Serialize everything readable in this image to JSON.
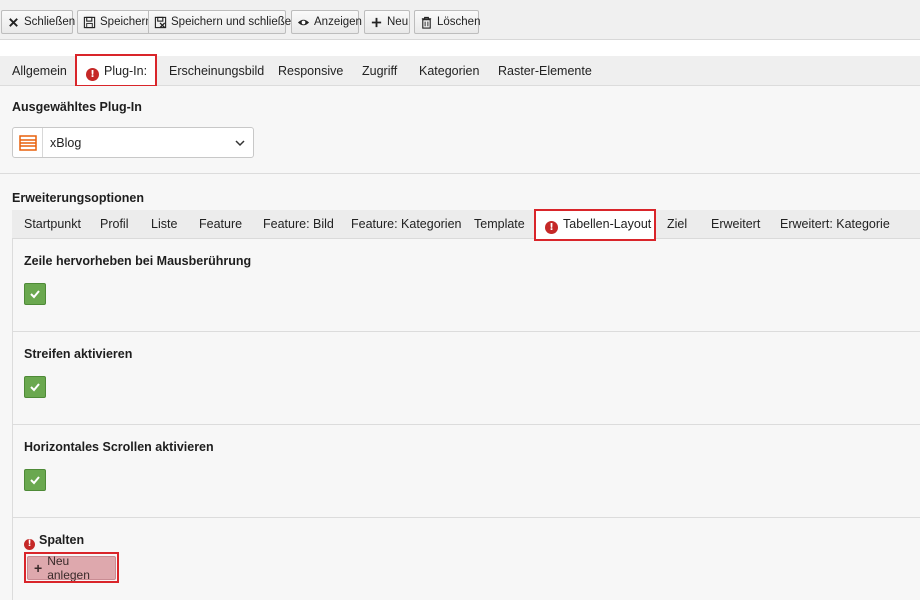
{
  "toolbar": {
    "close": "Schließen",
    "save": "Speichern",
    "save_close": "Speichern und schließen",
    "view": "Anzeigen",
    "new": "Neu",
    "delete": "Löschen"
  },
  "outer_tabs": [
    "Allgemein",
    "Plug-In:",
    "Erscheinungsbild",
    "Responsive",
    "Zugriff",
    "Kategorien",
    "Raster-Elemente"
  ],
  "selected_plugin": {
    "label": "Ausgewähltes Plug-In",
    "value": "xBlog"
  },
  "extension_options": {
    "label": "Erweiterungsoptionen",
    "tabs": [
      "Startpunkt",
      "Profil",
      "Liste",
      "Feature",
      "Feature: Bild",
      "Feature: Kategorien",
      "Template",
      "Tabellen-Layout",
      "Ziel",
      "Erweitert",
      "Erweitert: Kategorie"
    ]
  },
  "options": {
    "hover": "Zeile hervorheben bei Mausberührung",
    "stripes": "Streifen aktivieren",
    "hscroll": "Horizontales Scrollen aktivieren"
  },
  "columns": {
    "label": "Spalten",
    "new_button": "Neu anlegen"
  },
  "colors": {
    "error_red": "#d9252a",
    "check_green": "#6aa84f",
    "new_button_bg": "#dea8ad"
  }
}
